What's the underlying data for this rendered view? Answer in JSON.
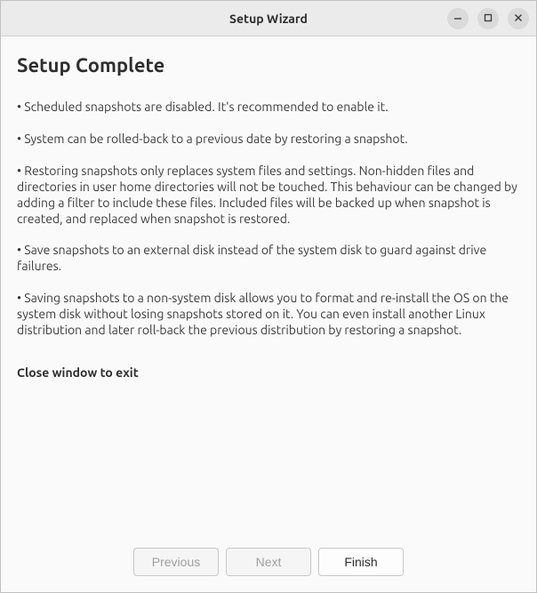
{
  "window": {
    "title": "Setup Wizard"
  },
  "page": {
    "heading": "Setup Complete",
    "bullets": [
      "• Scheduled snapshots are disabled. It's recommended to enable it.",
      "• System can be rolled-back to a previous date by restoring a snapshot.",
      "• Restoring snapshots only replaces system files and settings. Non-hidden files and directories in user home directories will not be touched. This behaviour can be changed by adding a filter to include these files. Included files will be backed up when snapshot is created, and replaced when snapshot is restored.",
      "• Save snapshots to an external disk instead of the system disk to guard against drive failures.",
      "• Saving snapshots to a non-system disk allows you to format and re-install the OS on the system disk without losing snapshots stored on it. You can even install another Linux distribution and later roll-back the previous distribution by restoring a snapshot."
    ],
    "exit_message": "Close window to exit"
  },
  "footer": {
    "previous": "Previous",
    "next": "Next",
    "finish": "Finish"
  }
}
